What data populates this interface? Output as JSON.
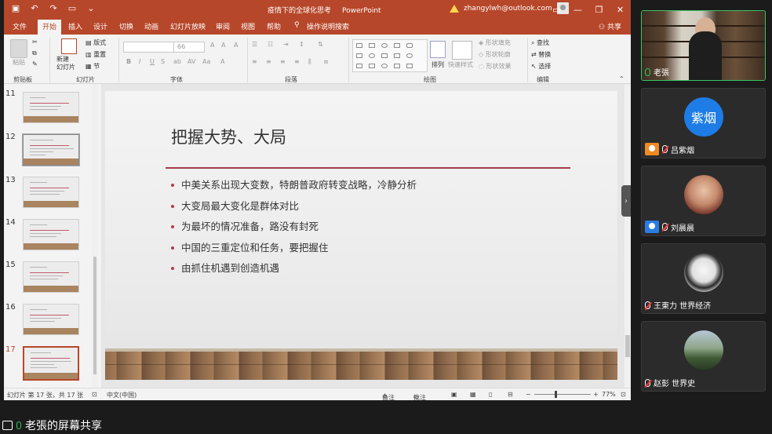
{
  "app": {
    "doc_title": "疫情下的全球化思考",
    "app_name": "PowerPoint",
    "account": "zhangylwh@outlook.com",
    "share_label": "共享"
  },
  "tabs": [
    "文件",
    "开始",
    "插入",
    "设计",
    "切换",
    "动画",
    "幻灯片放映",
    "审阅",
    "视图",
    "帮助",
    "操作说明搜索"
  ],
  "active_tab": "开始",
  "ribbon": {
    "groups": [
      "剪贴板",
      "幻灯片",
      "字体",
      "段落",
      "绘图",
      "编辑"
    ],
    "paste": "粘贴",
    "new_slide": "新建\n幻灯片",
    "layout": "版式",
    "reset": "重置",
    "section": "节",
    "font_size": "66",
    "arrange": "排列",
    "quick_styles": "快速样式",
    "shape_fill": "形状填充",
    "shape_outline": "形状轮廓",
    "shape_effects": "形状效果",
    "find": "查找",
    "replace": "替换",
    "select": "选择"
  },
  "thumbnails": [
    {
      "num": "11"
    },
    {
      "num": "12"
    },
    {
      "num": "13"
    },
    {
      "num": "14"
    },
    {
      "num": "15"
    },
    {
      "num": "16"
    },
    {
      "num": "17"
    }
  ],
  "slide": {
    "title": "把握大势、大局",
    "bullets": [
      "中美关系出现大变数，特朗普政府转变战略，冷静分析",
      "大变局最大变化是群体对比",
      "为最坏的情况准备，路没有封死",
      "中国的三重定位和任务，要把握住",
      "由抓住机遇到创造机遇"
    ]
  },
  "status": {
    "slide_count": "幻灯片 第 17 张，共 17 张",
    "language": "中文(中国)",
    "notes": "备注",
    "comments": "批注",
    "zoom": "77%"
  },
  "participants": [
    {
      "name": "老張",
      "avatar_text": ""
    },
    {
      "name": "吕紫烟",
      "avatar_text": "紫烟"
    },
    {
      "name": "刘晨晨",
      "avatar_text": ""
    },
    {
      "name": "王東力 世界经济",
      "avatar_text": ""
    },
    {
      "name": "赵彭 世界史",
      "avatar_text": ""
    }
  ],
  "screen_share_label": "老張的屏幕共享",
  "colors": {
    "ppt_accent": "#b7472a",
    "slide_rule": "#a33a4f",
    "active_speaker": "#39c466"
  }
}
